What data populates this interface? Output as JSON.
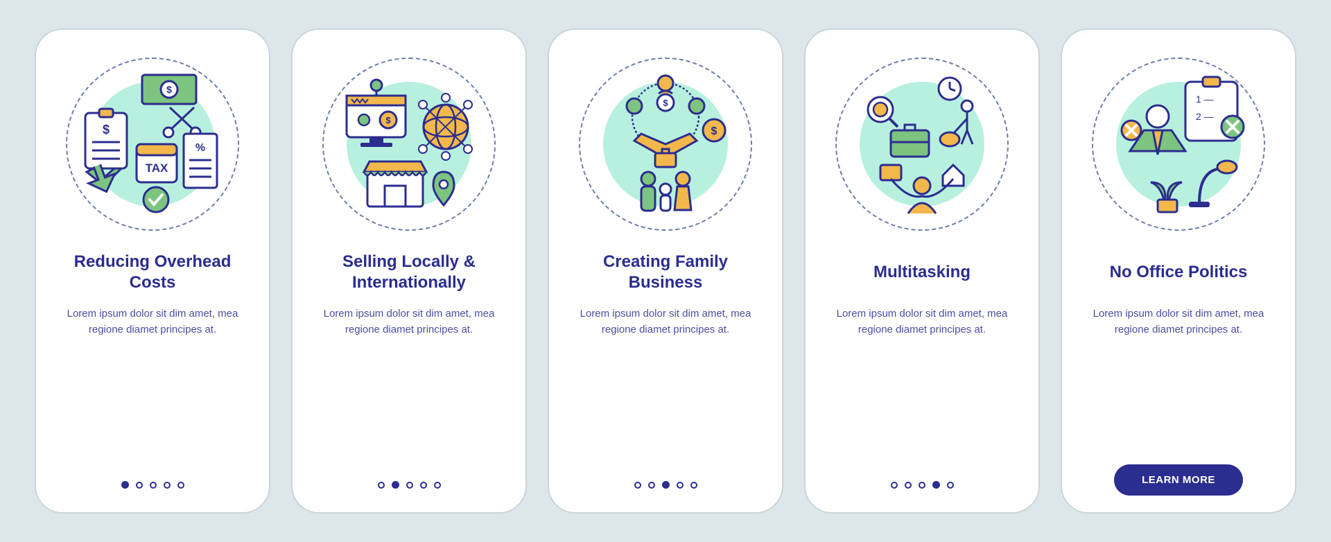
{
  "colors": {
    "primary": "#2b2d8f",
    "accent_green": "#7cc47f",
    "accent_yellow": "#f2b84b",
    "bg_mint": "#b8f0df",
    "page_bg": "#dce6eb"
  },
  "cta_label": "LEARN MORE",
  "screens": [
    {
      "icon": "overhead-costs-icon",
      "title": "Reducing Overhead Costs",
      "desc": "Lorem ipsum dolor sit dim amet, mea regione diamet principes at.",
      "active_index": 0,
      "total_dots": 5
    },
    {
      "icon": "selling-local-global-icon",
      "title": "Selling Locally & Internationally",
      "desc": "Lorem ipsum dolor sit dim amet, mea regione diamet principes at.",
      "active_index": 1,
      "total_dots": 5
    },
    {
      "icon": "family-business-icon",
      "title": "Creating Family Business",
      "desc": "Lorem ipsum dolor sit dim amet, mea regione diamet principes at.",
      "active_index": 2,
      "total_dots": 5
    },
    {
      "icon": "multitasking-icon",
      "title": "Multitasking",
      "desc": "Lorem ipsum dolor sit dim amet, mea regione diamet principes at.",
      "active_index": 3,
      "total_dots": 5
    },
    {
      "icon": "no-office-politics-icon",
      "title": "No Office Politics",
      "desc": "Lorem ipsum dolor sit dim amet, mea regione diamet principes at.",
      "active_index": 4,
      "total_dots": 5,
      "is_last": true
    }
  ]
}
